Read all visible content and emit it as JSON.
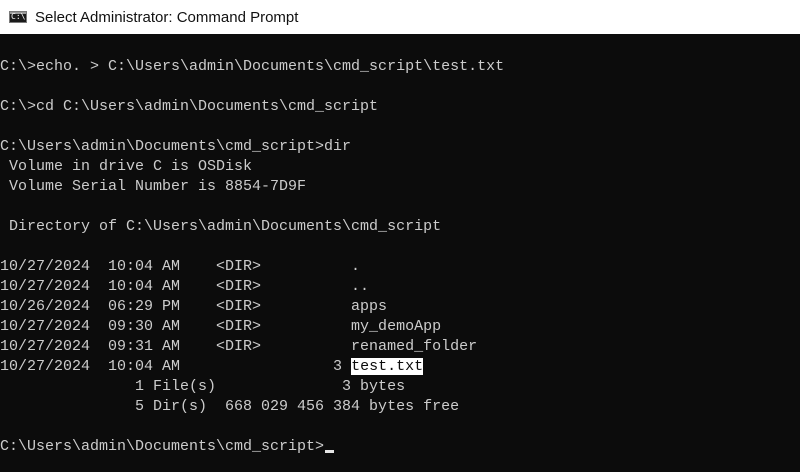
{
  "window": {
    "title": "Select Administrator: Command Prompt",
    "icon_label": "C:\\",
    "icon": "cmd-icon"
  },
  "colors": {
    "background": "#0c0c0c",
    "text": "#cccccc",
    "titlebar": "#ffffff",
    "selection": "#ffffff"
  },
  "console": {
    "cmd1": "C:\\>echo. > C:\\Users\\admin\\Documents\\cmd_script\\test.txt",
    "cmd2": "C:\\>cd C:\\Users\\admin\\Documents\\cmd_script",
    "cmd3": "C:\\Users\\admin\\Documents\\cmd_script>dir",
    "volume_label": " Volume in drive C is OSDisk",
    "volume_serial": " Volume Serial Number is 8854-7D9F",
    "directory_of": " Directory of C:\\Users\\admin\\Documents\\cmd_script",
    "entries": [
      "10/27/2024  10:04 AM    <DIR>          .",
      "10/27/2024  10:04 AM    <DIR>          ..",
      "10/26/2024  06:29 PM    <DIR>          apps",
      "10/27/2024  09:30 AM    <DIR>          my_demoApp",
      "10/27/2024  09:31 AM    <DIR>          renamed_folder",
      "10/27/2024  10:04 AM                 3 "
    ],
    "selected_file": "test.txt",
    "files_summary": "               1 File(s)              3 bytes",
    "dirs_summary": "               5 Dir(s)  668 029 456 384 bytes free",
    "prompt": "C:\\Users\\admin\\Documents\\cmd_script>"
  }
}
